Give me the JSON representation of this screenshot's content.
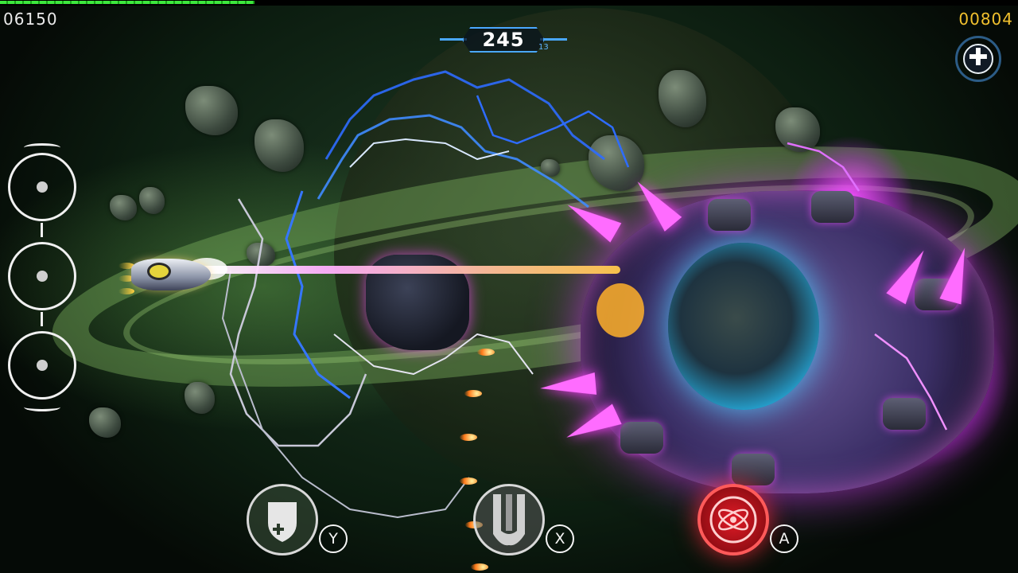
{
  "hud": {
    "score_left": "06150",
    "score_right": "00804",
    "energy_fraction": 0.25,
    "combo_value": "245",
    "combo_sub": "13"
  },
  "buttons": {
    "shield_key": "Y",
    "missile_key": "X",
    "special_key": "A"
  },
  "icons": {
    "add": "plus-icon",
    "shield": "shield-plus-icon",
    "missile": "missile-icon",
    "special": "atom-icon"
  },
  "colors": {
    "score_left": "#eaeaea",
    "score_right": "#f2c12e",
    "energy_bar": "#3ee83e",
    "combo_frame": "#4aa8ff",
    "special_button": "#e01a26"
  }
}
